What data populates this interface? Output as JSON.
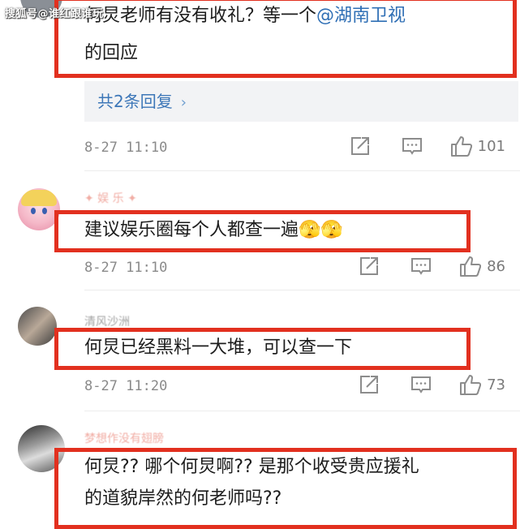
{
  "watermark": "搜狐号@谁红跟谁玩",
  "comments": [
    {
      "text_part1": "何炅老师有没有收礼？等一个",
      "mention": "@湖南卫视",
      "text_line2": "的回应",
      "replies_label": "共2条回复",
      "time": "8-27 11:10",
      "likes": "101"
    },
    {
      "username": "✦ 娱 乐 ✦",
      "text": "建议娱乐圈每个人都查一遍🫣🫣",
      "time": "8-27 11:10",
      "likes": "86"
    },
    {
      "username": "清风沙洲",
      "text": "何炅已经黑料一大堆，可以查一下",
      "time": "8-27 11:20",
      "likes": "73"
    },
    {
      "username": "梦想作没有翅膀",
      "text_line1": "何炅?? 哪个何炅啊?? 是那个收受贵应援礼",
      "text_line2": "的道貌岸然的何老师吗??"
    }
  ],
  "icons": {
    "share": "share-icon",
    "comment": "comment-icon",
    "like": "thumbs-up-icon"
  },
  "colors": {
    "highlight_box": "#e2301f",
    "mention": "#2f6fb5",
    "replies_link": "#3d77b8",
    "meta_text": "#8a8a8a"
  }
}
